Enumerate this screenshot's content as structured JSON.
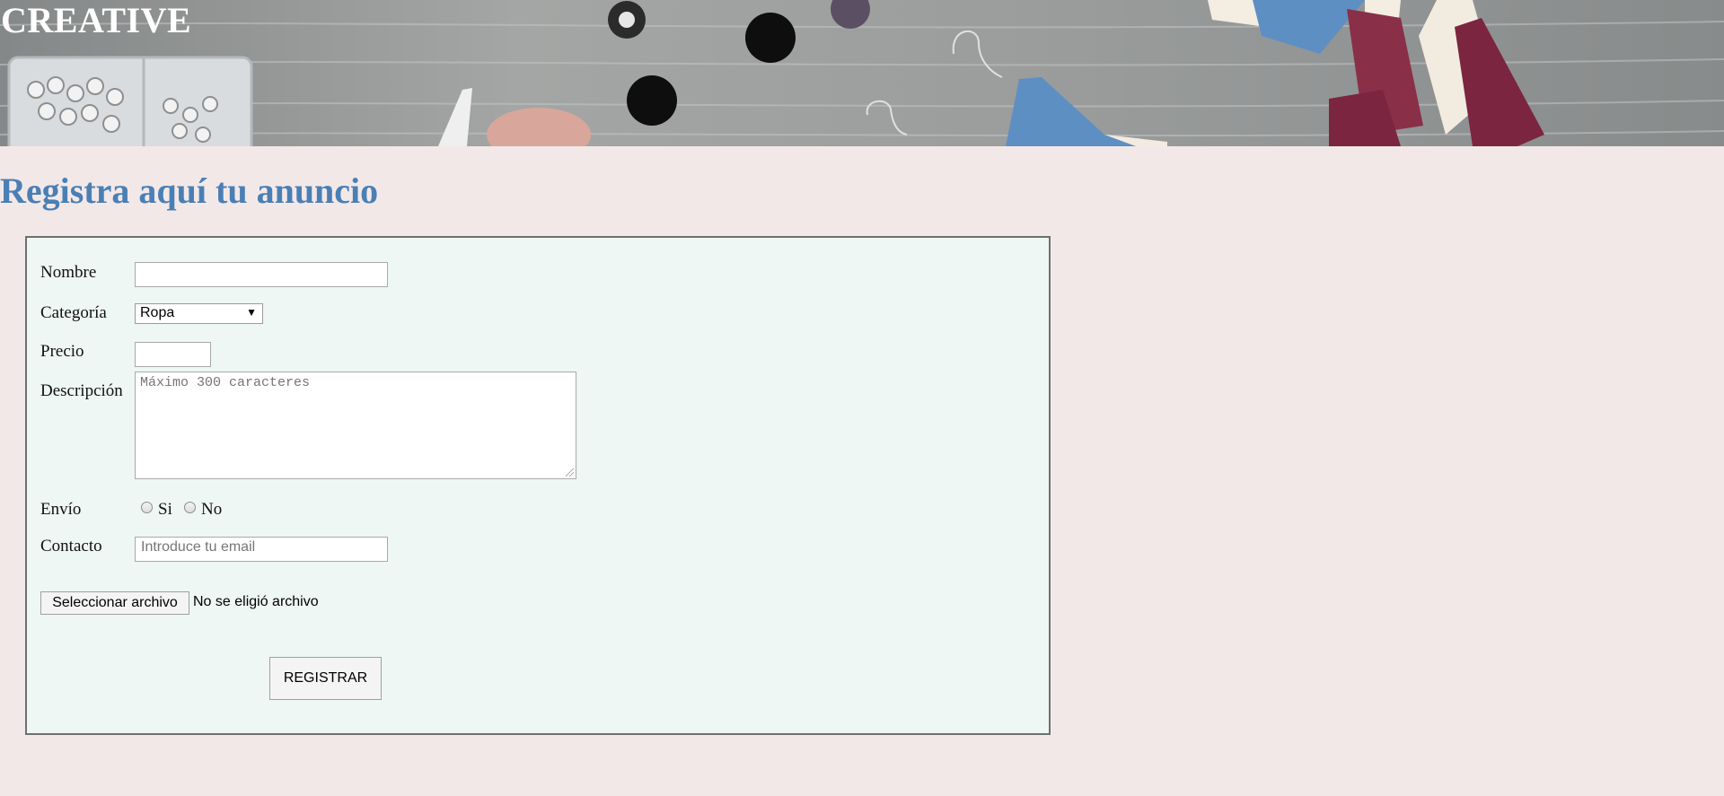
{
  "header": {
    "title": "CREATIVE"
  },
  "page": {
    "heading": "Registra aquí tu anuncio"
  },
  "form": {
    "nombre": {
      "label": "Nombre",
      "value": ""
    },
    "categoria": {
      "label": "Categoría",
      "selected": "Ropa"
    },
    "precio": {
      "label": "Precio",
      "value": ""
    },
    "descripcion": {
      "label": "Descripción",
      "placeholder": "Máximo 300 caracteres"
    },
    "envio": {
      "label": "Envío",
      "options": [
        "Si",
        "No"
      ]
    },
    "contacto": {
      "label": "Contacto",
      "placeholder": "Introduce tu email"
    },
    "file": {
      "button_label": "Seleccionar archivo",
      "status": "No se eligió archivo"
    },
    "submit_label": "REGISTRAR"
  },
  "colors": {
    "page_background": "#f3e8e8",
    "form_background": "#eef7f3",
    "heading": "#4a7fb5"
  }
}
